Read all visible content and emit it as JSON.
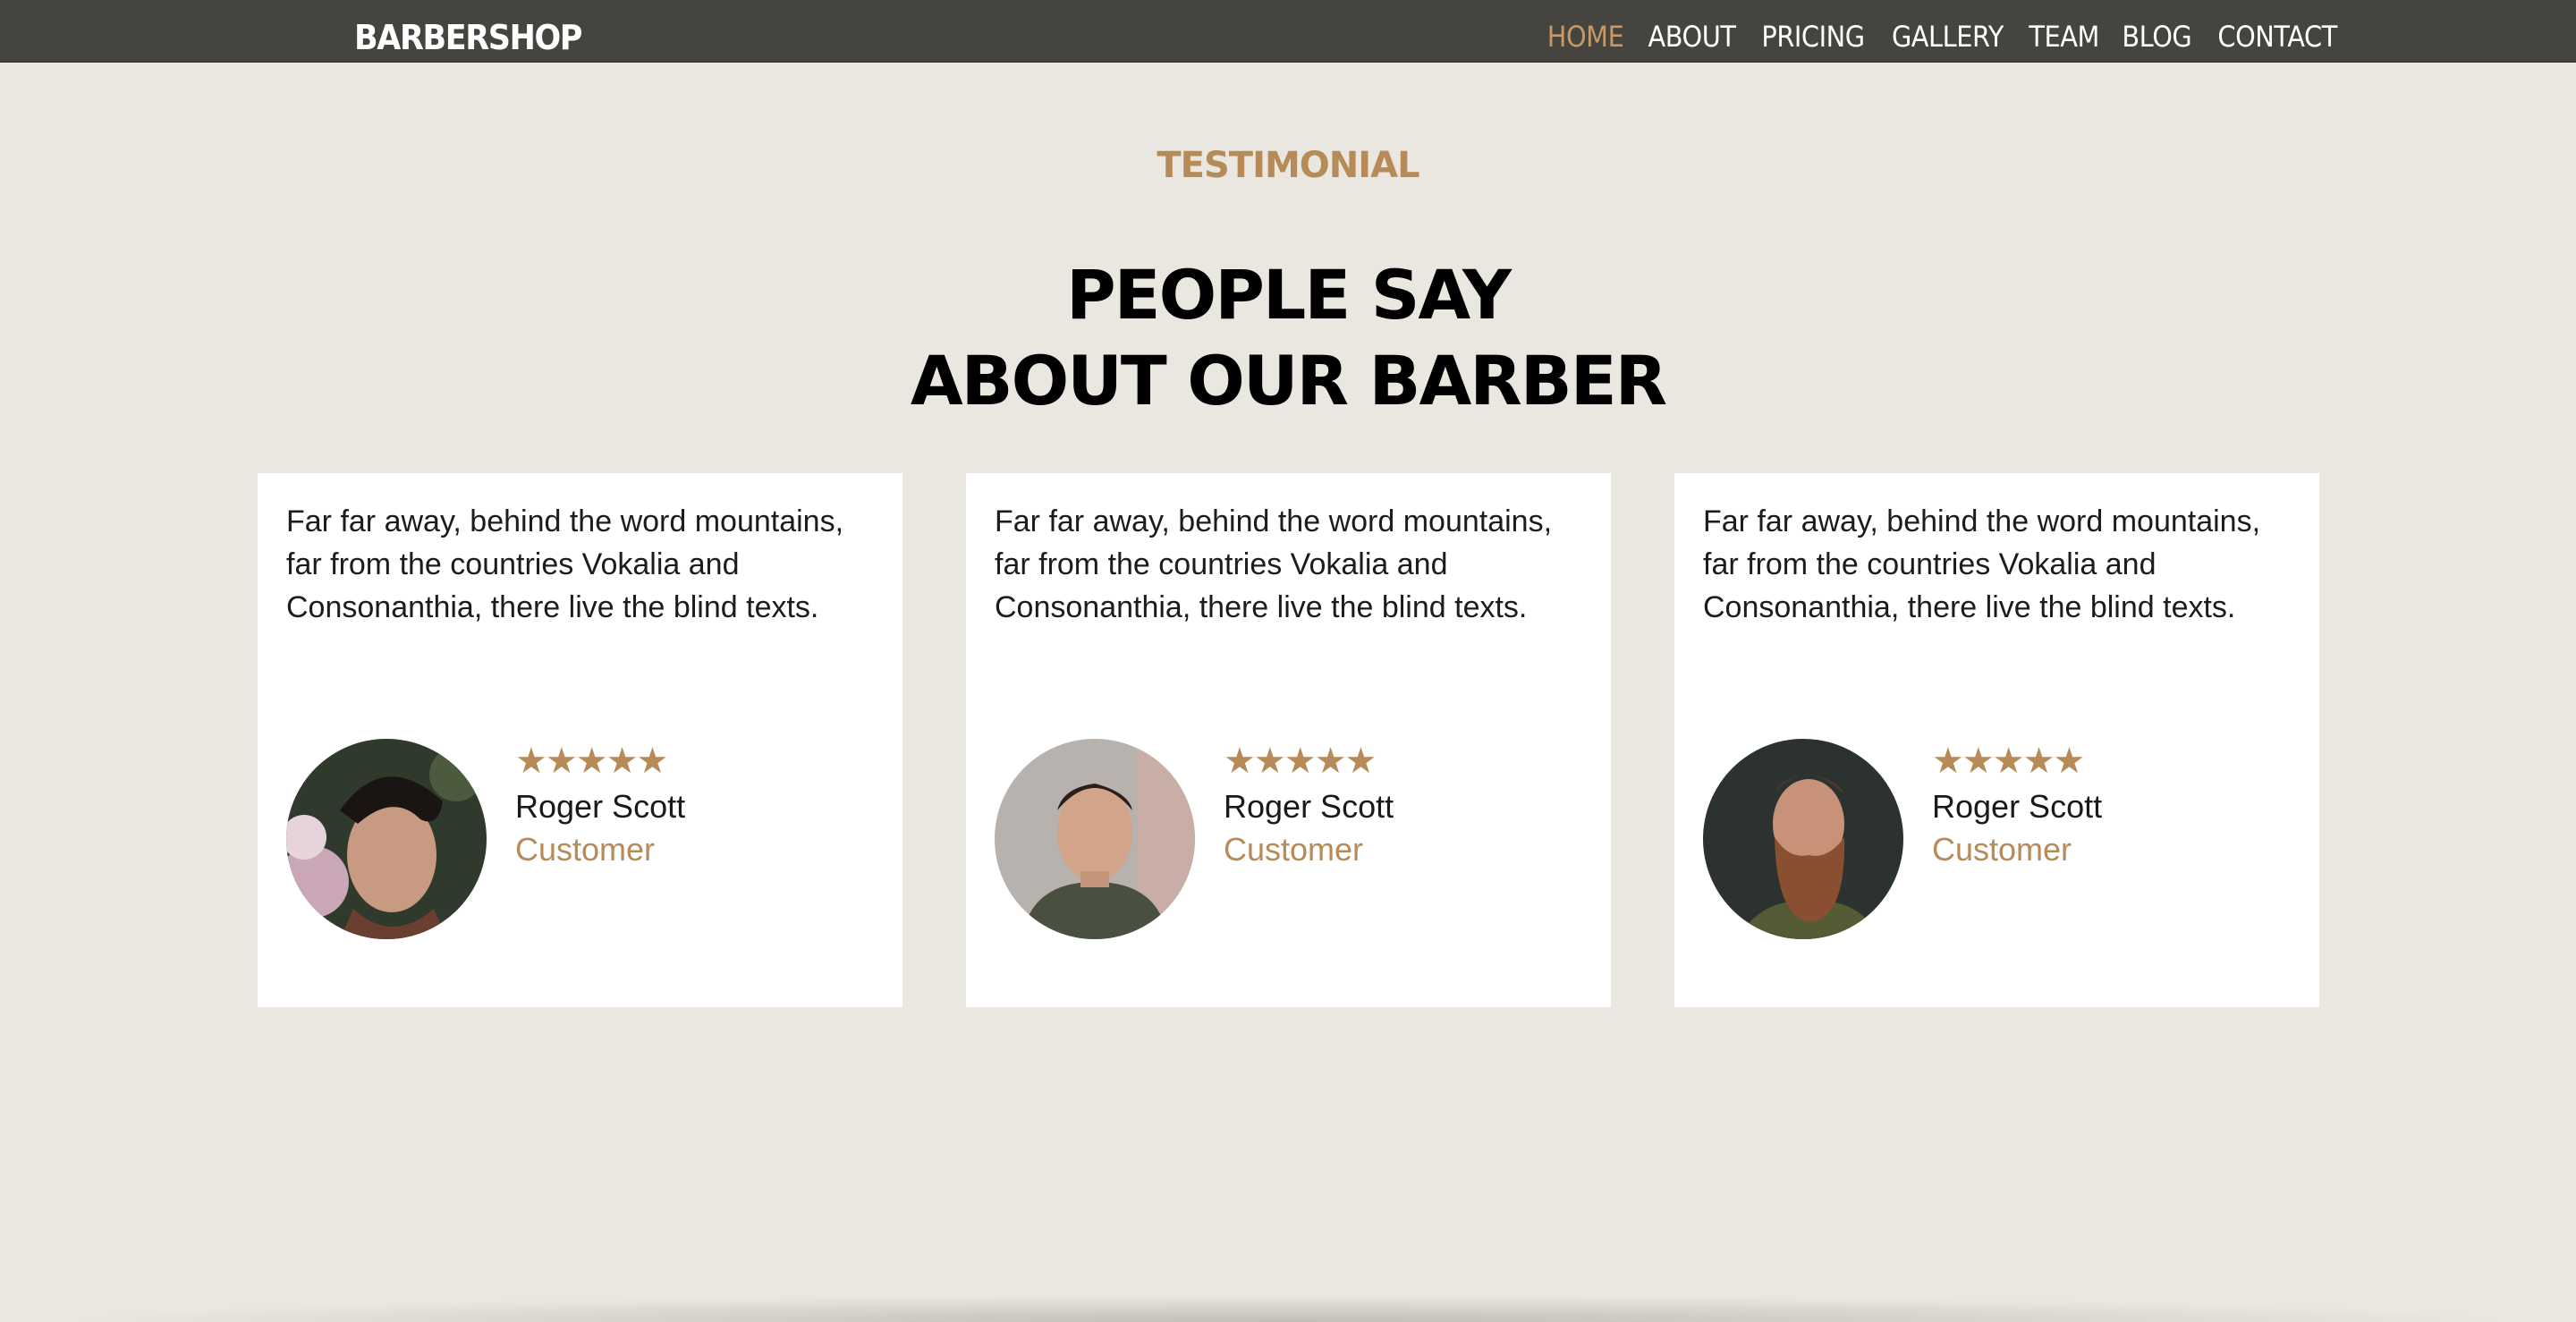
{
  "navbar": {
    "brand": "BARBERSHOP",
    "items": [
      {
        "label": "HOME",
        "active": true
      },
      {
        "label": "ABOUT",
        "active": false
      },
      {
        "label": "PRICING",
        "active": false
      },
      {
        "label": "GALLERY",
        "active": false
      },
      {
        "label": "TEAM",
        "active": false
      },
      {
        "label": "BLOG",
        "active": false
      },
      {
        "label": "CONTACT",
        "active": false
      }
    ]
  },
  "section": {
    "subheading": "TESTIMONIAL",
    "heading_line1": "PEOPLE SAY",
    "heading_line2": "ABOUT OUR BARBER"
  },
  "testimonials": [
    {
      "text": "Far far away, behind the word mountains, far from the countries Vokalia and Consonanthia, there live the blind texts.",
      "stars": "★★★★★",
      "rating": 5,
      "name": "Roger Scott",
      "role": "Customer",
      "avatar": "young-man-dark-hair-photo"
    },
    {
      "text": "Far far away, behind the word mountains, far from the countries Vokalia and Consonanthia, there live the blind texts.",
      "stars": "★★★★★",
      "rating": 5,
      "name": "Roger Scott",
      "role": "Customer",
      "avatar": "young-man-hoodie-photo"
    },
    {
      "text": "Far far away, behind the word mountains, far from the countries Vokalia and Consonanthia, there live the blind texts.",
      "stars": "★★★★★",
      "rating": 5,
      "name": "Roger Scott",
      "role": "Customer",
      "avatar": "bearded-man-photo"
    }
  ],
  "colors": {
    "accent": "#b68b58",
    "navbar": "#45443f",
    "background": "#e9e7df"
  }
}
